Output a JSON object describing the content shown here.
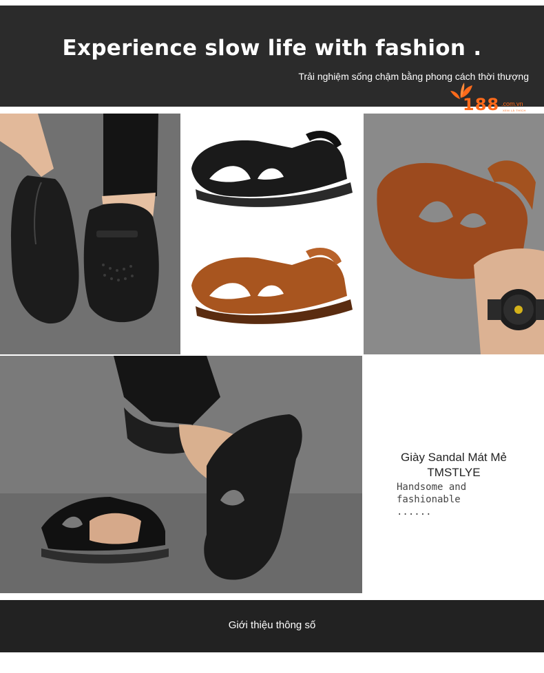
{
  "header": {
    "headline": "Experience slow life with fashion .",
    "subline": "Trải nghiệm sống chậm bằng phong cách thời thượng"
  },
  "logo": {
    "number": "188",
    "domain": ".com.vn",
    "tagline": "XEM LÀ THÍCH"
  },
  "product": {
    "name_line1": "Giày Sandal Mát Mẻ",
    "name_line2": "TMSTLYE",
    "tagline": "Handsome and\nfashionable\n......"
  },
  "footer": {
    "section_title": "Giới thiệu thông số"
  },
  "colors": {
    "banner": "#2b2b2b",
    "accent": "#ff6a1a",
    "black_leather": "#1b1b1b",
    "brown_leather": "#a0522d"
  }
}
